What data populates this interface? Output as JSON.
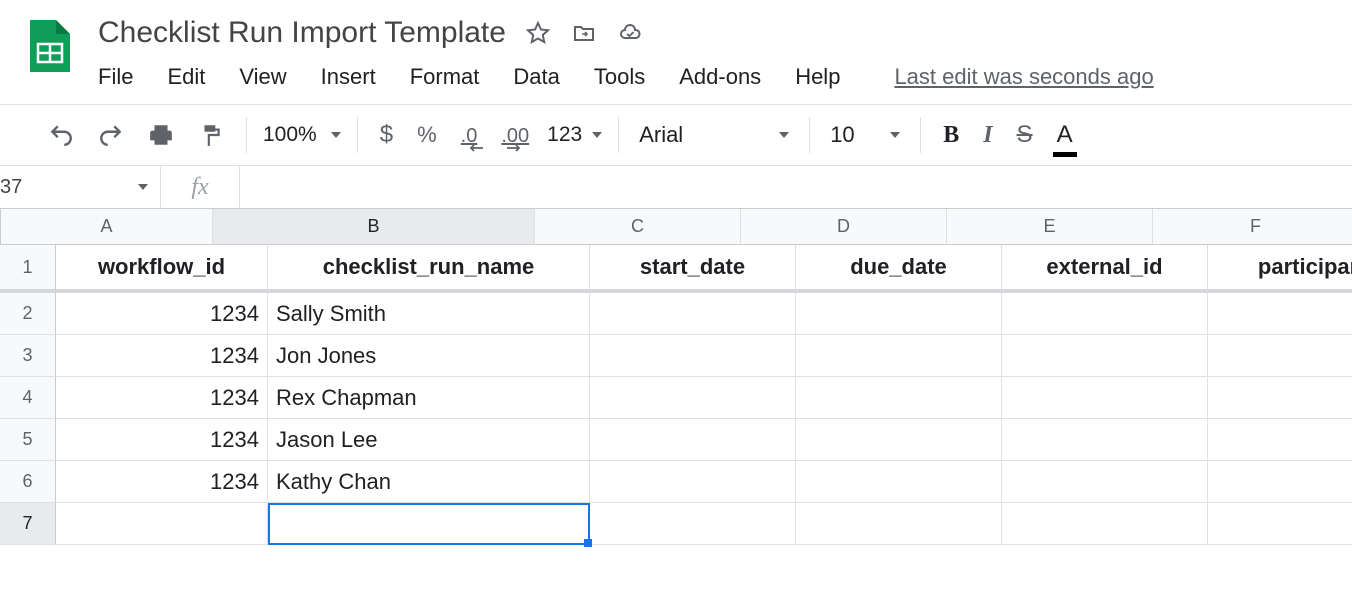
{
  "doc": {
    "title": "Checklist Run Import Template"
  },
  "menu": {
    "file": "File",
    "edit": "Edit",
    "view": "View",
    "insert": "Insert",
    "format": "Format",
    "data": "Data",
    "tools": "Tools",
    "addons": "Add-ons",
    "help": "Help",
    "last_edit": "Last edit was seconds ago"
  },
  "toolbar": {
    "zoom": "100%",
    "currency": "$",
    "percent": "%",
    "dec_dec": ".0",
    "inc_dec": ".00",
    "more_formats": "123",
    "font": "Arial",
    "size": "10",
    "bold": "B",
    "italic": "I",
    "strike": "S",
    "textcolor": "A"
  },
  "formula": {
    "namebox": "37",
    "fx": "fx"
  },
  "columns": [
    "A",
    "B",
    "C",
    "D",
    "E",
    "F"
  ],
  "rows": [
    "1",
    "2",
    "3",
    "4",
    "5",
    "6",
    "7"
  ],
  "headers": [
    "workflow_id",
    "checklist_run_name",
    "start_date",
    "due_date",
    "external_id",
    "participan"
  ],
  "data": [
    {
      "a": "1234",
      "b": "Sally Smith"
    },
    {
      "a": "1234",
      "b": "Jon Jones"
    },
    {
      "a": "1234",
      "b": "Rex Chapman"
    },
    {
      "a": "1234",
      "b": "Jason Lee"
    },
    {
      "a": "1234",
      "b": "Kathy Chan"
    }
  ]
}
